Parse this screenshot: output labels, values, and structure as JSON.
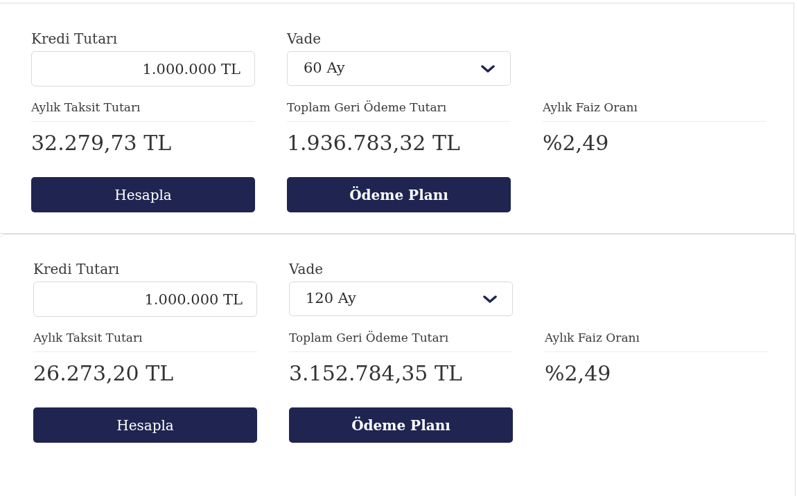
{
  "calculators": [
    {
      "loan_amount": {
        "label": "Kredi Tutarı",
        "value": "1.000.000 TL"
      },
      "term": {
        "label": "Vade",
        "value": "60 Ay"
      },
      "results": [
        {
          "label": "Aylık Taksit Tutarı",
          "value": "32.279,73 TL"
        },
        {
          "label": "Toplam Geri Ödeme Tutarı",
          "value": "1.936.783,32 TL"
        },
        {
          "label": "Aylık Faiz Oranı",
          "value": "%2,49"
        }
      ],
      "buttons": [
        {
          "label": "Hesapla",
          "bold": false
        },
        {
          "label": "Ödeme Planı",
          "bold": true
        }
      ]
    },
    {
      "loan_amount": {
        "label": "Kredi Tutarı",
        "value": "1.000.000 TL"
      },
      "term": {
        "label": "Vade",
        "value": "120 Ay"
      },
      "results": [
        {
          "label": "Aylık Taksit Tutarı",
          "value": "26.273,20 TL"
        },
        {
          "label": "Toplam Geri Ödeme Tutarı",
          "value": "3.152.784,35 TL"
        },
        {
          "label": "Aylık Faiz Oranı",
          "value": "%2,49"
        }
      ],
      "buttons": [
        {
          "label": "Hesapla",
          "bold": false
        },
        {
          "label": "Ödeme Planı",
          "bold": true
        }
      ]
    }
  ]
}
